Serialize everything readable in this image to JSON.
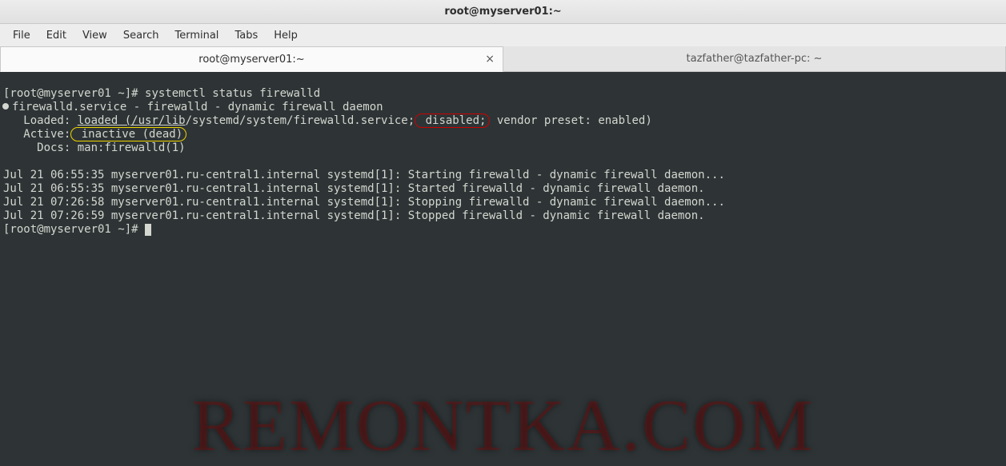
{
  "window": {
    "title": "root@myserver01:~"
  },
  "menu": {
    "file": "File",
    "edit": "Edit",
    "view": "View",
    "search": "Search",
    "terminal": "Terminal",
    "tabs": "Tabs",
    "help": "Help"
  },
  "tabs": {
    "active": "root@myserver01:~",
    "inactive": "tazfather@tazfather-pc: ~"
  },
  "terminal": {
    "prompt1a": "[root@myserver01 ~]# ",
    "command1": "systemctl status firewalld",
    "service_header": "firewalld.service - firewalld - dynamic firewall daemon",
    "loaded_label": "   Loaded: ",
    "loaded_ul_1": "loaded (/usr/lib",
    "loaded_mid": "/systemd/system/firewalld.service;",
    "disabled_red": " disabled;",
    "loaded_tail": " vendor preset: enabled)",
    "active_label": "   Active:",
    "active_yellow": " inactive (dead)",
    "docs_line": "     Docs: man:firewalld(1)",
    "log1": "Jul 21 06:55:35 myserver01.ru-central1.internal systemd[1]: Starting firewalld - dynamic firewall daemon...",
    "log2": "Jul 21 06:55:35 myserver01.ru-central1.internal systemd[1]: Started firewalld - dynamic firewall daemon.",
    "log3": "Jul 21 07:26:58 myserver01.ru-central1.internal systemd[1]: Stopping firewalld - dynamic firewall daemon...",
    "log4": "Jul 21 07:26:59 myserver01.ru-central1.internal systemd[1]: Stopped firewalld - dynamic firewall daemon.",
    "prompt2": "[root@myserver01 ~]# "
  },
  "watermark": "REMONTKA.COM"
}
